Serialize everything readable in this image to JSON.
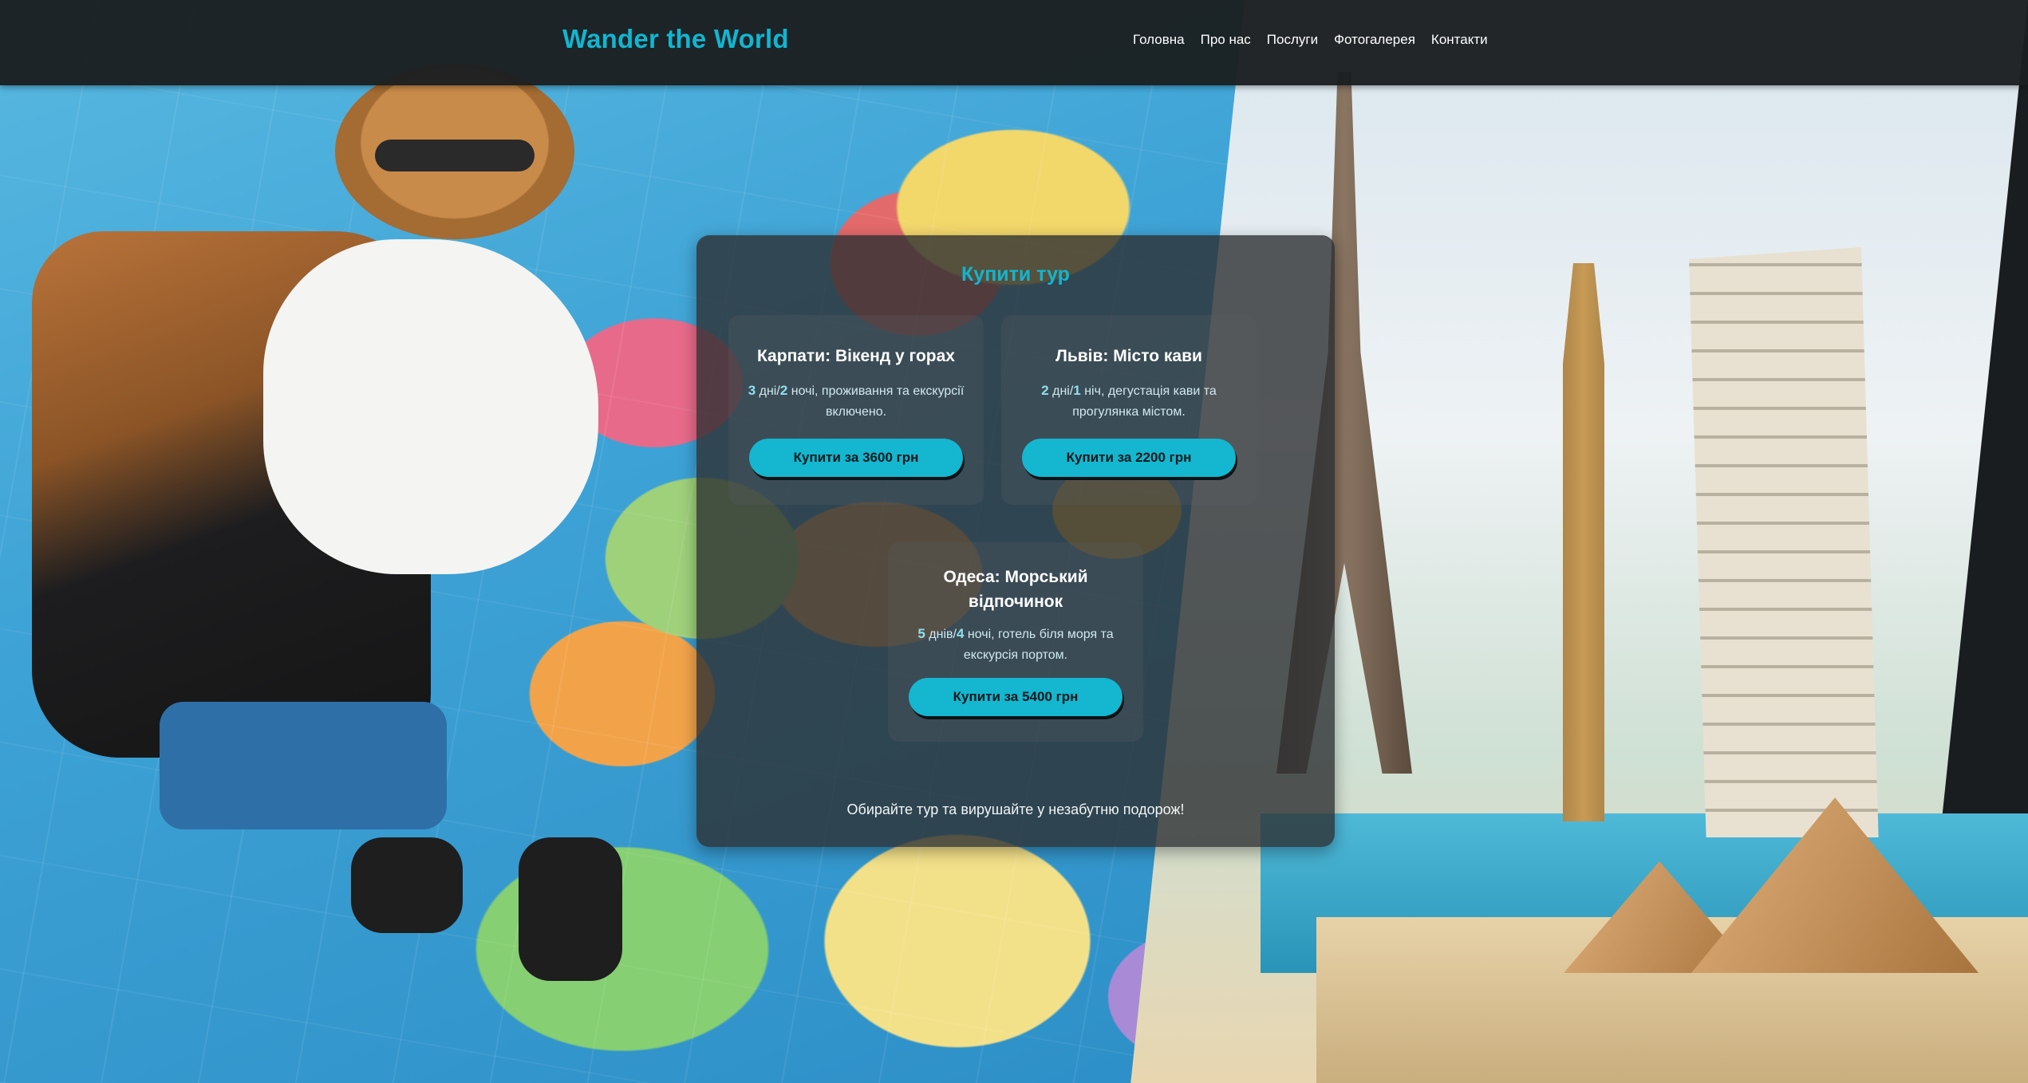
{
  "header": {
    "logo": "Wander the World",
    "nav": [
      "Головна",
      "Про нас",
      "Послуги",
      "Фотогалерея",
      "Контакти"
    ]
  },
  "tours_panel": {
    "title": "Купити тур",
    "tours": [
      {
        "title": "Карпати: Вікенд у горах",
        "days": "3",
        "days_word": "дні",
        "nights": "2",
        "nights_word": "ночі",
        "desc_tail": ", проживання та екскурсії включено.",
        "button": "Купити за 3600 грн"
      },
      {
        "title": "Львів: Місто кави",
        "days": "2",
        "days_word": "дні",
        "nights": "1",
        "nights_word": "ніч",
        "desc_tail": ", дегустація кави та прогулянка містом.",
        "button": "Купити за 2200 грн"
      },
      {
        "title": "Одеса: Морський відпочинок",
        "days": "5",
        "days_word": "днів",
        "nights": "4",
        "nights_word": "ночі",
        "desc_tail": ", готель біля моря та екскурсія портом.",
        "button": "Купити за 5400 грн"
      }
    ],
    "footer": "Обирайте тур та вирушайте у незабутню подорож!"
  },
  "colors": {
    "accent": "#12b5d0",
    "header_bg": "#1a1e1f",
    "panel_bg": "#2d3032"
  }
}
